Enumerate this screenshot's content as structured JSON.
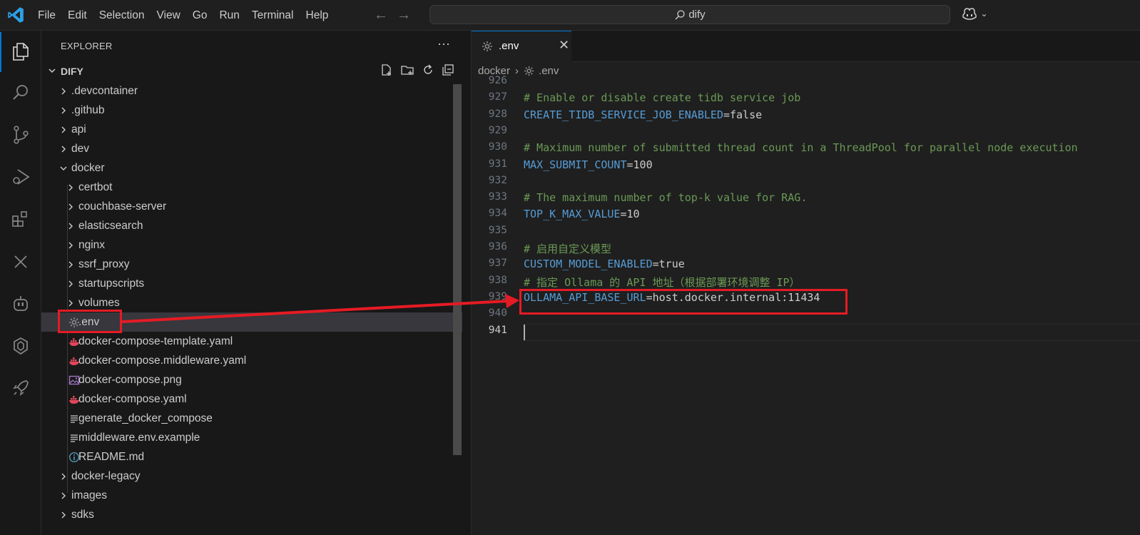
{
  "menu": [
    "File",
    "Edit",
    "Selection",
    "View",
    "Go",
    "Run",
    "Terminal",
    "Help"
  ],
  "search": {
    "text": "dify"
  },
  "explorer": {
    "header": "EXPLORER",
    "more": "···",
    "root": "DIFY",
    "items": [
      {
        "label": ".devcontainer",
        "kind": "folder",
        "depth": 0,
        "expanded": false
      },
      {
        "label": ".github",
        "kind": "folder",
        "depth": 0,
        "expanded": false
      },
      {
        "label": "api",
        "kind": "folder",
        "depth": 0,
        "expanded": false
      },
      {
        "label": "dev",
        "kind": "folder",
        "depth": 0,
        "expanded": false
      },
      {
        "label": "docker",
        "kind": "folder",
        "depth": 0,
        "expanded": true
      },
      {
        "label": "certbot",
        "kind": "folder",
        "depth": 1,
        "expanded": false
      },
      {
        "label": "couchbase-server",
        "kind": "folder",
        "depth": 1,
        "expanded": false
      },
      {
        "label": "elasticsearch",
        "kind": "folder",
        "depth": 1,
        "expanded": false
      },
      {
        "label": "nginx",
        "kind": "folder",
        "depth": 1,
        "expanded": false
      },
      {
        "label": "ssrf_proxy",
        "kind": "folder",
        "depth": 1,
        "expanded": false
      },
      {
        "label": "startupscripts",
        "kind": "folder",
        "depth": 1,
        "expanded": false
      },
      {
        "label": "volumes",
        "kind": "folder",
        "depth": 1,
        "expanded": false
      },
      {
        "label": ".env",
        "kind": "gear-icon",
        "depth": 1,
        "selected": true
      },
      {
        "label": "docker-compose-template.yaml",
        "kind": "docker-icon",
        "depth": 1
      },
      {
        "label": "docker-compose.middleware.yaml",
        "kind": "docker-icon",
        "depth": 1
      },
      {
        "label": "docker-compose.png",
        "kind": "image-icon",
        "depth": 1
      },
      {
        "label": "docker-compose.yaml",
        "kind": "docker-icon",
        "depth": 1
      },
      {
        "label": "generate_docker_compose",
        "kind": "text-icon",
        "depth": 1
      },
      {
        "label": "middleware.env.example",
        "kind": "text-icon",
        "depth": 1
      },
      {
        "label": "README.md",
        "kind": "info-icon",
        "depth": 1
      },
      {
        "label": "docker-legacy",
        "kind": "folder",
        "depth": 0,
        "expanded": false
      },
      {
        "label": "images",
        "kind": "folder",
        "depth": 0,
        "expanded": false
      },
      {
        "label": "sdks",
        "kind": "folder",
        "depth": 0,
        "expanded": false
      }
    ]
  },
  "tab": {
    "label": ".env",
    "close": "✕"
  },
  "breadcrumb": {
    "folder": "docker",
    "sep": "›",
    "file": ".env"
  },
  "code": [
    {
      "n": "926",
      "parts": []
    },
    {
      "n": "927",
      "parts": [
        {
          "t": "# Enable or disable create tidb service job",
          "c": "cmt"
        }
      ]
    },
    {
      "n": "928",
      "parts": [
        {
          "t": "CREATE_TIDB_SERVICE_JOB_ENABLED",
          "c": "key"
        },
        {
          "t": "=false",
          "c": "val"
        }
      ]
    },
    {
      "n": "929",
      "parts": []
    },
    {
      "n": "930",
      "parts": [
        {
          "t": "# Maximum number of submitted thread count in a ThreadPool for parallel node execution",
          "c": "cmt"
        }
      ]
    },
    {
      "n": "931",
      "parts": [
        {
          "t": "MAX_SUBMIT_COUNT",
          "c": "key"
        },
        {
          "t": "=100",
          "c": "val"
        }
      ]
    },
    {
      "n": "932",
      "parts": []
    },
    {
      "n": "933",
      "parts": [
        {
          "t": "# The maximum number of top-k value for RAG.",
          "c": "cmt"
        }
      ]
    },
    {
      "n": "934",
      "parts": [
        {
          "t": "TOP_K_MAX_VALUE",
          "c": "key"
        },
        {
          "t": "=10",
          "c": "val"
        }
      ]
    },
    {
      "n": "935",
      "parts": []
    },
    {
      "n": "936",
      "parts": [
        {
          "t": "# 启用自定义模型",
          "c": "cmt"
        }
      ]
    },
    {
      "n": "937",
      "parts": [
        {
          "t": "CUSTOM_MODEL_ENABLED",
          "c": "key"
        },
        {
          "t": "=true",
          "c": "val"
        }
      ]
    },
    {
      "n": "938",
      "parts": [
        {
          "t": "# 指定 Ollama 的 API 地址（根据部署环境调整 IP）",
          "c": "cmt"
        }
      ]
    },
    {
      "n": "939",
      "parts": [
        {
          "t": "OLLAMA_API_BASE_URL",
          "c": "key"
        },
        {
          "t": "=host.docker.internal:11434",
          "c": "val"
        }
      ]
    },
    {
      "n": "940",
      "parts": []
    },
    {
      "n": "941",
      "parts": [],
      "current": true
    }
  ],
  "colors": {
    "accent": "#0078d4",
    "annotation": "#e51b24",
    "comment": "#6a9955",
    "key": "#569cd6"
  }
}
